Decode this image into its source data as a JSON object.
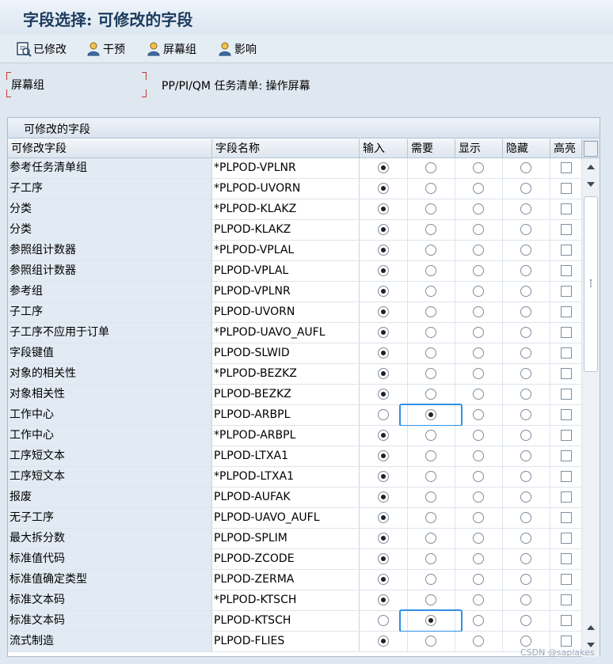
{
  "title": "字段选择: 可修改的字段",
  "toolbar": {
    "modified": "已修改",
    "intervene": "干预",
    "screen_group": "屏幕组",
    "influence": "影响"
  },
  "info": {
    "label": "屏幕组",
    "text": "PP/PI/QM 任务清单: 操作屏幕"
  },
  "panel": {
    "title": "可修改的字段"
  },
  "columns": {
    "field": "可修改字段",
    "name": "字段名称",
    "input": "输入",
    "required": "需要",
    "display": "显示",
    "hidden": "隐藏",
    "highlight": "高亮"
  },
  "rows": [
    {
      "field": "参考任务清单组",
      "name": "*PLPOD-VPLNR",
      "selected": "input"
    },
    {
      "field": "子工序",
      "name": "*PLPOD-UVORN",
      "selected": "input"
    },
    {
      "field": "分类",
      "name": "*PLPOD-KLAKZ",
      "selected": "input"
    },
    {
      "field": "分类",
      "name": "PLPOD-KLAKZ",
      "selected": "input"
    },
    {
      "field": "参照组计数器",
      "name": "*PLPOD-VPLAL",
      "selected": "input"
    },
    {
      "field": "参照组计数器",
      "name": "PLPOD-VPLAL",
      "selected": "input"
    },
    {
      "field": "参考组",
      "name": "PLPOD-VPLNR",
      "selected": "input"
    },
    {
      "field": "子工序",
      "name": "PLPOD-UVORN",
      "selected": "input"
    },
    {
      "field": "子工序不应用于订单",
      "name": "*PLPOD-UAVO_AUFL",
      "selected": "input"
    },
    {
      "field": "字段键值",
      "name": "PLPOD-SLWID",
      "selected": "input"
    },
    {
      "field": "对象的相关性",
      "name": "*PLPOD-BEZKZ",
      "selected": "input"
    },
    {
      "field": "对象相关性",
      "name": "PLPOD-BEZKZ",
      "selected": "input"
    },
    {
      "field": "工作中心",
      "name": "PLPOD-ARBPL",
      "selected": "required"
    },
    {
      "field": "工作中心",
      "name": "*PLPOD-ARBPL",
      "selected": "input"
    },
    {
      "field": "工序短文本",
      "name": "PLPOD-LTXA1",
      "selected": "input"
    },
    {
      "field": "工序短文本",
      "name": "*PLPOD-LTXA1",
      "selected": "input"
    },
    {
      "field": "报废",
      "name": "PLPOD-AUFAK",
      "selected": "input"
    },
    {
      "field": "无子工序",
      "name": "PLPOD-UAVO_AUFL",
      "selected": "input"
    },
    {
      "field": "最大拆分数",
      "name": "PLPOD-SPLIM",
      "selected": "input"
    },
    {
      "field": "标准值代码",
      "name": "PLPOD-ZCODE",
      "selected": "input"
    },
    {
      "field": "标准值确定类型",
      "name": "PLPOD-ZERMA",
      "selected": "input"
    },
    {
      "field": "标准文本码",
      "name": "*PLPOD-KTSCH",
      "selected": "input"
    },
    {
      "field": "标准文本码",
      "name": "PLPOD-KTSCH",
      "selected": "required"
    },
    {
      "field": "流式制造",
      "name": "PLPOD-FLIES",
      "selected": "input"
    }
  ],
  "watermark": "CSDN @saplakes"
}
